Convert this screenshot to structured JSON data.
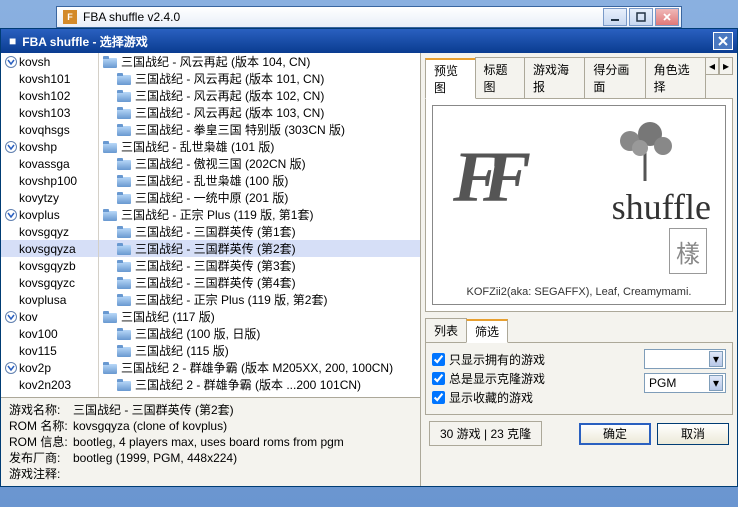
{
  "outer": {
    "title": "FBA shuffle v2.4.0"
  },
  "dialog": {
    "title": "FBA shuffle - 选择游戏"
  },
  "left_tree": [
    {
      "expand": true,
      "name": "kovsh"
    },
    {
      "indent": 1,
      "name": "kovsh101"
    },
    {
      "indent": 1,
      "name": "kovsh102"
    },
    {
      "indent": 1,
      "name": "kovsh103"
    },
    {
      "indent": 1,
      "name": "kovqhsgs"
    },
    {
      "expand": true,
      "name": "kovshp"
    },
    {
      "indent": 1,
      "name": "kovassga"
    },
    {
      "indent": 1,
      "name": "kovshp100"
    },
    {
      "indent": 1,
      "name": "kovytzy"
    },
    {
      "expand": true,
      "name": "kovplus"
    },
    {
      "indent": 1,
      "name": "kovsgqyz"
    },
    {
      "indent": 1,
      "name": "kovsgqyza",
      "sel": true
    },
    {
      "indent": 1,
      "name": "kovsgqyzb"
    },
    {
      "indent": 1,
      "name": "kovsgqyzc"
    },
    {
      "indent": 1,
      "name": "kovplusa"
    },
    {
      "expand": true,
      "name": "kov"
    },
    {
      "indent": 1,
      "name": "kov100"
    },
    {
      "indent": 1,
      "name": "kov115"
    },
    {
      "expand": true,
      "name": "kov2p"
    },
    {
      "indent": 1,
      "name": "kov2n203"
    }
  ],
  "right_tree": [
    {
      "folder": true,
      "name": "三国战纪 - 风云再起 (版本 104, CN)"
    },
    {
      "folder": true,
      "indent": 1,
      "name": "三国战纪 - 风云再起 (版本 101, CN)"
    },
    {
      "folder": true,
      "indent": 1,
      "name": "三国战纪 - 风云再起 (版本 102, CN)"
    },
    {
      "folder": true,
      "indent": 1,
      "name": "三国战纪 - 风云再起 (版本 103, CN)"
    },
    {
      "folder": true,
      "indent": 1,
      "name": "三国战纪 - 拳皇三国 特别版 (303CN 版)"
    },
    {
      "folder": true,
      "name": "三国战纪 - 乱世枭雄 (101 版)"
    },
    {
      "folder": true,
      "indent": 1,
      "name": "三国战纪 - 傲视三国 (202CN 版)"
    },
    {
      "folder": true,
      "indent": 1,
      "name": "三国战纪 - 乱世枭雄 (100 版)"
    },
    {
      "folder": true,
      "indent": 1,
      "name": "三国战纪 - 一统中原 (201 版)"
    },
    {
      "folder": true,
      "name": "三国战纪 - 正宗 Plus (119 版, 第1套)"
    },
    {
      "folder": true,
      "indent": 1,
      "name": "三国战纪 - 三国群英传 (第1套)"
    },
    {
      "folder": true,
      "indent": 1,
      "name": "三国战纪 - 三国群英传 (第2套)",
      "sel": true
    },
    {
      "folder": true,
      "indent": 1,
      "name": "三国战纪 - 三国群英传 (第3套)"
    },
    {
      "folder": true,
      "indent": 1,
      "name": "三国战纪 - 三国群英传 (第4套)"
    },
    {
      "folder": true,
      "indent": 1,
      "name": "三国战纪 - 正宗 Plus (119 版, 第2套)"
    },
    {
      "folder": true,
      "name": "三国战纪 (117 版)"
    },
    {
      "folder": true,
      "indent": 1,
      "name": "三国战纪 (100 版, 日版)"
    },
    {
      "folder": true,
      "indent": 1,
      "name": "三国战纪 (115 版)"
    },
    {
      "folder": true,
      "name": "三国战纪 2 - 群雄争霸 (版本 M205XX, 200, 100CN)"
    },
    {
      "folder": true,
      "indent": 1,
      "name": "三国战纪 2 - 群雄争霸 (版本 ...200 101CN)"
    }
  ],
  "info": {
    "rows": [
      {
        "k": "游戏名称:",
        "v": "三国战纪 - 三国群英传 (第2套)"
      },
      {
        "k": "ROM 名称:",
        "v": "kovsgqyza (clone of kovplus)"
      },
      {
        "k": "ROM 信息:",
        "v": "bootleg, 4 players max, uses board roms from pgm"
      },
      {
        "k": "发布厂商:",
        "v": "bootleg (1999, PGM, 448x224)"
      },
      {
        "k": "游戏注释:",
        "v": ""
      }
    ]
  },
  "preview_tabs": [
    "预览图",
    "标题图",
    "游戏海报",
    "得分画面",
    "角色选择"
  ],
  "preview_caption": "KOFZii2(aka: SEGAFFX), Leaf, Creamymami.",
  "filter_tabs": [
    "列表",
    "筛选"
  ],
  "filter_checks": [
    {
      "label": "只显示拥有的游戏",
      "checked": true
    },
    {
      "label": "总是显示克隆游戏",
      "checked": true
    },
    {
      "label": "显示收藏的游戏",
      "checked": true
    }
  ],
  "combos": [
    {
      "value": ""
    },
    {
      "value": "PGM"
    }
  ],
  "status": "30 游戏 | 23 克隆",
  "buttons": {
    "ok": "确定",
    "cancel": "取消"
  }
}
